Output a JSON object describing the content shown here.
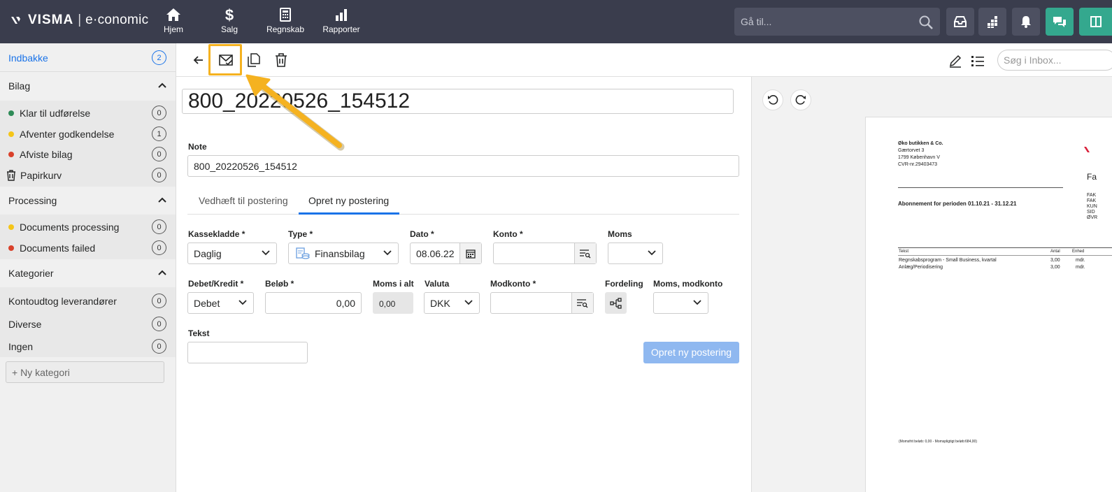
{
  "app": {
    "brand": "VISMA",
    "separator": "|",
    "product": "e·conomic"
  },
  "nav": [
    {
      "label": "Hjem",
      "icon": "home-icon"
    },
    {
      "label": "Salg",
      "icon": "dollar-icon"
    },
    {
      "label": "Regnskab",
      "icon": "calculator-icon"
    },
    {
      "label": "Rapporter",
      "icon": "bar-chart-icon"
    }
  ],
  "search": {
    "placeholder": "Gå til..."
  },
  "sidebar": {
    "inbox": {
      "label": "Indbakke",
      "count": "2"
    },
    "bilag": {
      "title": "Bilag",
      "items": [
        {
          "label": "Klar til udførelse",
          "count": "0",
          "color": "#2e8b57"
        },
        {
          "label": "Afventer godkendelse",
          "count": "1",
          "color": "#f5c518"
        },
        {
          "label": "Afviste bilag",
          "count": "0",
          "color": "#d9412b"
        },
        {
          "label": "Papirkurv",
          "count": "0"
        }
      ]
    },
    "processing": {
      "title": "Processing",
      "items": [
        {
          "label": "Documents processing",
          "count": "0",
          "color": "#f5c518"
        },
        {
          "label": "Documents failed",
          "count": "0",
          "color": "#d9412b"
        }
      ]
    },
    "kategorier": {
      "title": "Kategorier",
      "items": [
        {
          "label": "Kontoudtog leverandører",
          "count": "0"
        },
        {
          "label": "Diverse",
          "count": "0"
        },
        {
          "label": "Ingen",
          "count": "0"
        }
      ]
    },
    "new_category": "+ Ny kategori"
  },
  "inbox_search": {
    "placeholder": "Søg i Inbox..."
  },
  "document": {
    "title": "800_20220526_154512",
    "note_label": "Note",
    "note_value": "800_20220526_154512"
  },
  "tabs": [
    {
      "label": "Vedhæft til postering"
    },
    {
      "label": "Opret ny postering"
    }
  ],
  "form": {
    "kassekladde": {
      "label": "Kassekladde *",
      "value": "Daglig"
    },
    "type": {
      "label": "Type *",
      "value": "Finansbilag"
    },
    "dato": {
      "label": "Dato *",
      "value": "08.06.22"
    },
    "konto": {
      "label": "Konto *",
      "value": ""
    },
    "moms": {
      "label": "Moms",
      "value": ""
    },
    "debetkredit": {
      "label": "Debet/Kredit *",
      "value": "Debet"
    },
    "beloeb": {
      "label": "Beløb *",
      "value": "0,00"
    },
    "moms_i_alt": {
      "label": "Moms i alt",
      "value": "0,00"
    },
    "valuta": {
      "label": "Valuta",
      "value": "DKK"
    },
    "modkonto": {
      "label": "Modkonto *",
      "value": ""
    },
    "fordeling": {
      "label": "Fordeling"
    },
    "moms_modkonto": {
      "label": "Moms, modkonto",
      "value": ""
    },
    "tekst": {
      "label": "Tekst",
      "value": ""
    },
    "submit": "Opret ny postering"
  },
  "preview": {
    "company": "Øko butikken & Co.",
    "street": "Gærtorvet 3",
    "city": "1799 København V",
    "cvr": "CVR-nr.29403473",
    "heading": "Abonnement for perioden 01.10.21 - 31.12.21",
    "cols": [
      "Tekst",
      "Antal",
      "Enhed"
    ],
    "rows": [
      {
        "text": "Regnskabsprogram - Small Business, kvartal",
        "qty": "3,00",
        "unit": "mdr."
      },
      {
        "text": "Anlæg/Periodisering",
        "qty": "3,00",
        "unit": "mdr."
      }
    ],
    "footer": "(Momsfrit beløb: 0,00 - Momspligtigt beløb:684,00)",
    "right_title": "Fa",
    "right_lines": [
      "FAK",
      "FAK",
      "KUN",
      "SID",
      "ØVR"
    ]
  },
  "colors": {
    "topbar": "#3a3d4d",
    "accent": "#1a73e8",
    "highlight": "#f5b220",
    "submit": "#8fb8f0"
  }
}
